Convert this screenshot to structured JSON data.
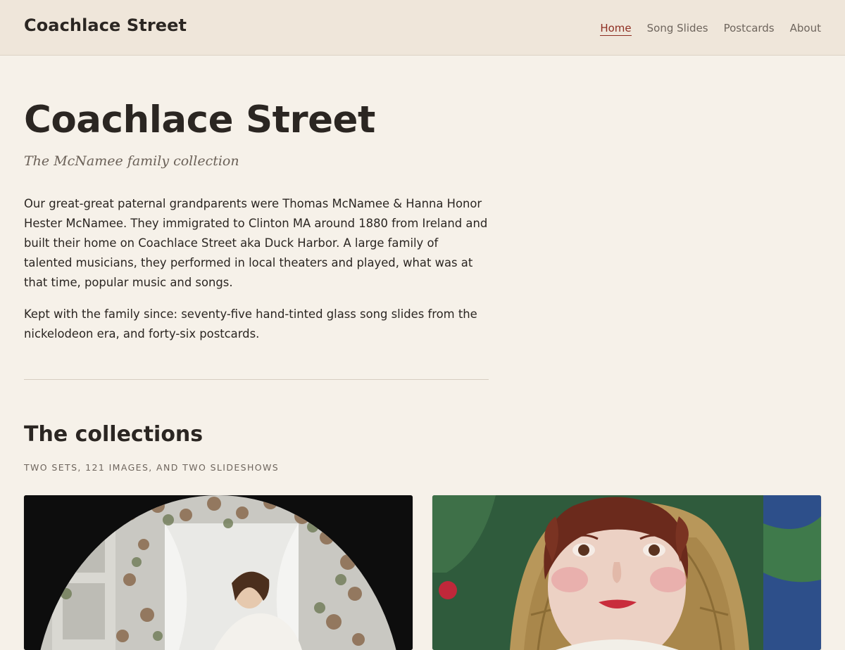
{
  "header": {
    "site_title": "Coachlace Street",
    "nav": [
      {
        "label": "Home",
        "active": true
      },
      {
        "label": "Song Slides",
        "active": false
      },
      {
        "label": "Postcards",
        "active": false
      },
      {
        "label": "About",
        "active": false
      }
    ]
  },
  "hero": {
    "title": "Coachlace Street",
    "subtitle": "The McNamee family collection",
    "paragraphs": [
      "Our great-great paternal grandparents were Thomas McNamee & Hanna Honor Hester McNamee. They immigrated to Clinton MA around 1880 from Ireland and built their home on Coachlace Street aka Duck Harbor. A large family of talented musicians, they performed in local theaters and played, what was at that time, popular music and songs.",
      "Kept with the family since: seventy-five hand-tinted glass song slides from the nickelodeon era, and forty-six postcards."
    ]
  },
  "collections": {
    "title": "The collections",
    "meta": "Two sets, 121 images, and two slideshows",
    "cards": [
      {
        "name": "song-slides-card"
      },
      {
        "name": "postcards-card"
      }
    ]
  },
  "colors": {
    "accent": "#8e2e22",
    "background": "#f6f1e9",
    "header_bg": "#efe6da"
  }
}
